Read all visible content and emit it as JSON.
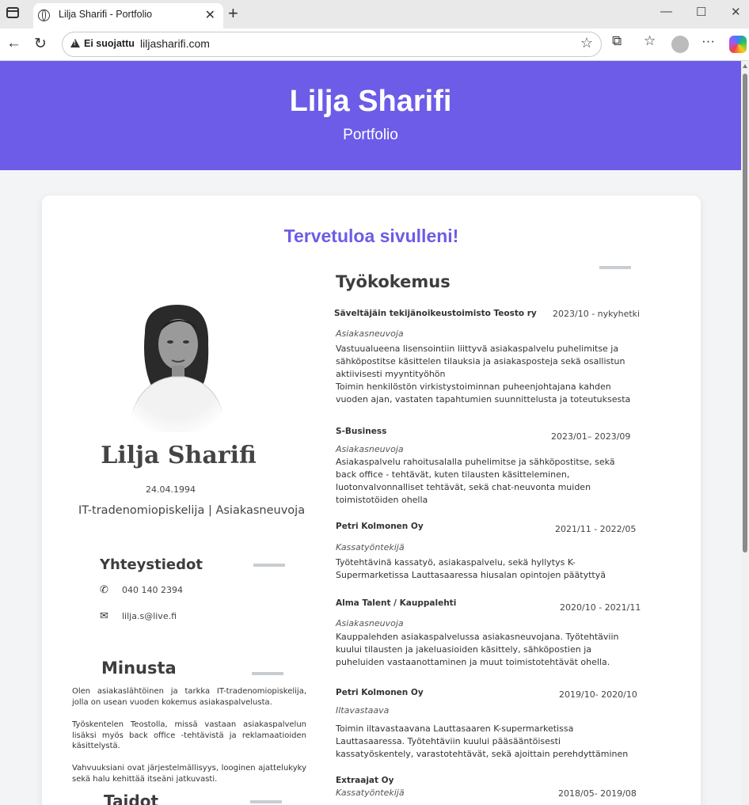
{
  "browser": {
    "tab_title": "Lilja Sharifi - Portfolio",
    "security_label": "Ei suojattu",
    "url": "liljasharifi.com"
  },
  "site": {
    "name": "Lilja Sharifi",
    "subtitle": "Portfolio",
    "welcome": "Tervetuloa sivulleni!"
  },
  "cv": {
    "name": "Lilja Sharifi",
    "birthdate": "24.04.1994",
    "role": "IT-tradenomiopiskelija | Asiakasneuvoja",
    "contact": {
      "heading": "Yhteystiedot",
      "phone": "040 140 2394",
      "email": "lilja.s@live.fi"
    },
    "about": {
      "heading": "Minusta",
      "paragraphs": [
        "Olen asiakaslähtöinen ja tarkka IT-tradenomiopiskelija, jolla on usean vuoden kokemus asiakaspalvelusta.",
        "Työskentelen Teostolla, missä vastaan asiakaspalvelun lisäksi myös back office -tehtävistä ja reklamaatioiden käsittelystä.",
        "Vahvuuksiani ovat järjestelmällisyys, looginen ajattelukyky sekä halu kehittää itseäni jatkuvasti."
      ]
    },
    "skills_heading": "Taidot",
    "experience": {
      "heading": "Työkokemus",
      "jobs": [
        {
          "company": "Säveltäjäin tekijänoikeustoimisto Teosto ry",
          "dates": "2023/10 - nykyhetki",
          "role": "Asiakasneuvoja",
          "desc": "Vastuualueena lisensointiin liittyvä asiakaspalvelu puhelimitse ja sähköpostitse käsittelen tilauksia ja asiakasposteja sekä osallistun aktiivisesti myyntityöhön\nToimin henkilöstön virkistystoiminnan puheenjohtajana kahden vuoden ajan, vastaten tapahtumien suunnittelusta ja toteutuksesta"
        },
        {
          "company": "S-Business",
          "dates": "2023/01– 2023/09",
          "role": "Asiakasneuvoja",
          "desc": "Asiakaspalvelu rahoitusalalla puhelimitse ja sähköpostitse, sekä back office - tehtävät, kuten tilausten käsitteleminen, luotonvalvonnalliset tehtävät, sekä chat-neuvonta muiden toimistotöiden ohella"
        },
        {
          "company": "Petri Kolmonen Oy",
          "dates": "2021/11 - 2022/05",
          "role": "Kassatyöntekijä",
          "desc": "Työtehtävinä kassatyö, asiakaspalvelu, sekä hyllytys K-Supermarketissa Lauttasaaressa hiusalan opintojen päätyttyä"
        },
        {
          "company": "Alma Talent / Kauppalehti",
          "dates": "2020/10 - 2021/11",
          "role": "Asiakasneuvoja",
          "desc": "Kauppalehden asiakaspalvelussa asiakasneuvojana. Työtehtäviin kuului tilausten ja jakeluasioiden käsittely, sähköpostien ja puheluiden vastaanottaminen ja muut toimistotehtävät ohella."
        },
        {
          "company": "Petri Kolmonen Oy",
          "dates": "2019/10- 2020/10",
          "role": "Iltavastaava",
          "desc": "Toimin iltavastaavana Lauttasaaren K-supermarketissa Lauttasaaressa. Työtehtäviin kuului pääsääntöisesti kassatyöskentely, varastotehtävät, sekä ajoittain perehdyttäminen"
        },
        {
          "company": "Extraajat Oy",
          "dates": "2018/05- 2019/08",
          "role": "Kassatyöntekijä",
          "desc": ""
        }
      ]
    }
  }
}
